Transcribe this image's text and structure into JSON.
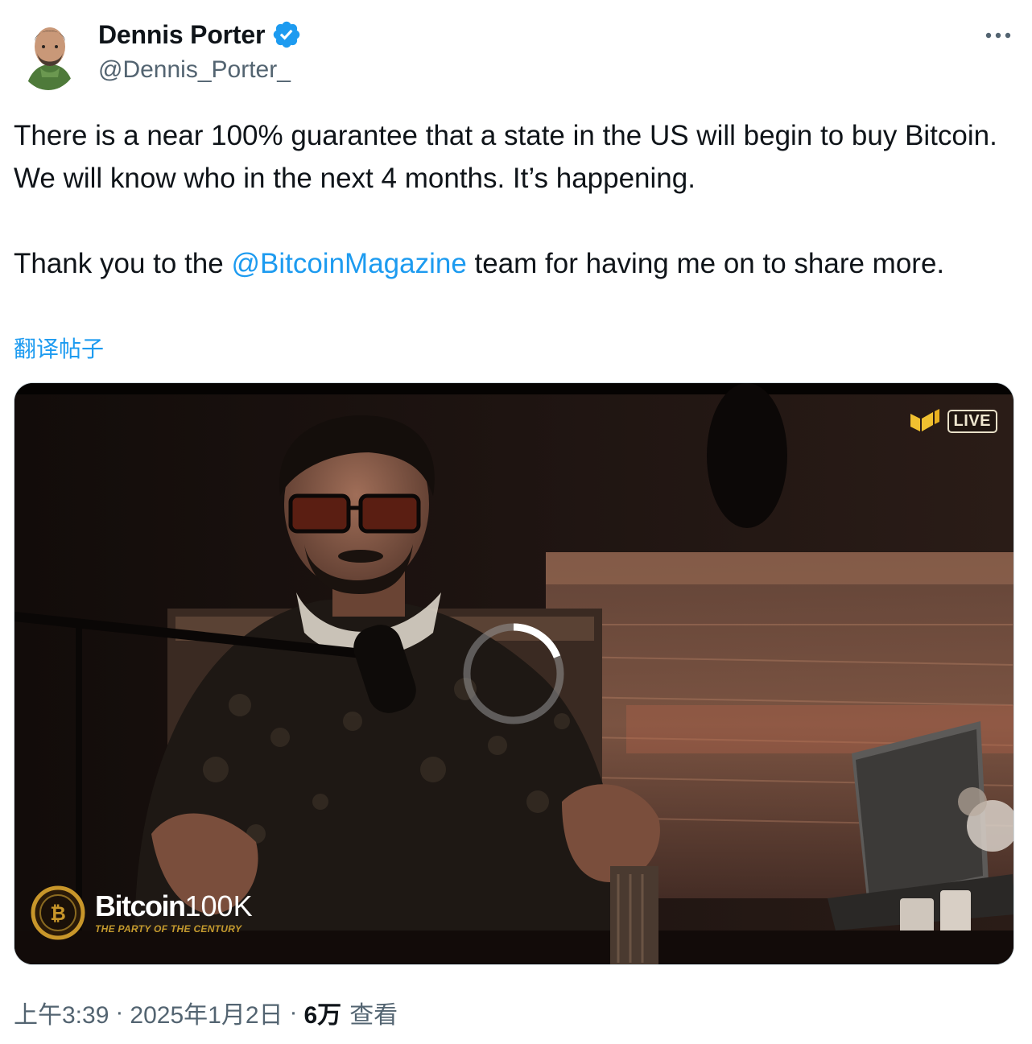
{
  "author": {
    "display_name": "Dennis Porter",
    "handle": "@Dennis_Porter_",
    "verified": true,
    "verified_color": "#1d9bf0"
  },
  "tweet": {
    "line1_text": "There is a near 100% guarantee that a state in the US will begin to buy Bitcoin. We will know who in the next 4 months. It’s happening.",
    "line2_prefix": "Thank you to the ",
    "line2_mention": "@BitcoinMagazine",
    "line2_suffix": " team for having me on to share more.",
    "translate_label": "翻译帖子"
  },
  "media": {
    "type": "video",
    "state": "loading",
    "live_badge": "LIVE",
    "event_title_bold": "Bitcoin",
    "event_title_thin": "100K",
    "event_subtitle": "THE PARTY OF THE CENTURY"
  },
  "meta": {
    "time": "上午3:39",
    "date": "2025年1月2日",
    "separator": "·",
    "views_count": "6万",
    "views_label": "查看"
  },
  "colors": {
    "text_primary": "#0f1419",
    "text_secondary": "#536471",
    "link": "#1d9bf0",
    "border": "#cfd9de"
  },
  "icons": [
    "verified-badge-icon",
    "more-options-icon",
    "live-logo-icon",
    "loading-spinner-icon",
    "event-coin-icon"
  ]
}
